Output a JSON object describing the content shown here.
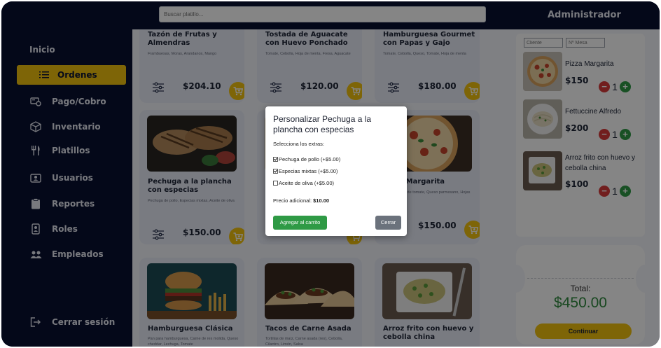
{
  "header": {
    "search_placeholder": "Buscar platillo...",
    "admin_label": "Administrador"
  },
  "sidebar": {
    "inicio": "Inicio",
    "items": [
      {
        "label": "Ordenes",
        "icon": "list-icon"
      },
      {
        "label": "Pago/Cobro",
        "icon": "payment-icon"
      },
      {
        "label": "Inventario",
        "icon": "box-icon"
      },
      {
        "label": "Platillos",
        "icon": "utensils-icon"
      },
      {
        "label": "Usuarios",
        "icon": "id-card-icon"
      },
      {
        "label": "Reportes",
        "icon": "clipboard-icon"
      },
      {
        "label": "Roles",
        "icon": "badge-icon"
      },
      {
        "label": "Empleados",
        "icon": "users-icon"
      }
    ],
    "logout": "Cerrar sesión"
  },
  "products": [
    {
      "title": "Tazón de Frutas y Almendras",
      "desc": "Frambuesas, Moras, Arandanos, Mango",
      "price": "$204.10"
    },
    {
      "title": "Tostada de Aguacate con Huevo Ponchado",
      "desc": "Tomate, Cebolla, Hoja de menta, Fresa, Aguacate",
      "price": "$120.00"
    },
    {
      "title": "Hamburguesa Gourmet con Papas y Gajo",
      "desc": "Tomate, Cebolla, Queso, Tomate, Hoja de menta",
      "price": "$180.00"
    },
    {
      "title": "Pechuga a la plancha con especias",
      "desc": "Pechuga de pollo, Especias mixtas, Aceite de oliva",
      "price": "$150.00"
    },
    {
      "title": "",
      "desc": "",
      "price": ""
    },
    {
      "title": "Pizza Margarita",
      "desc": "Queso, Salsa de tomate, Queso parmesano, Hojas de albahaca",
      "price": "$150.00"
    },
    {
      "title": "Hamburguesa Clásica",
      "desc": "Pan para hamburguesa, Carne de res molida, Queso cheddar, Lechuga, Tomate",
      "price": ""
    },
    {
      "title": "Tacos de Carne Asada",
      "desc": "Tortillas de maíz, Carne asada (res), Cebolla, Cilantro, Limón, Salsa",
      "price": ""
    },
    {
      "title": "Arroz frito con huevo y cebolla china",
      "desc": "",
      "price": ""
    }
  ],
  "order": {
    "client_placeholder": "Cliente",
    "table_placeholder": "Nº Mesa",
    "items": [
      {
        "name": "Pizza Margarita",
        "price": "$150",
        "qty": "1"
      },
      {
        "name": "Fettuccine Alfredo",
        "price": "$200",
        "qty": "1"
      },
      {
        "name": "Arroz frito con huevo y cebolla china",
        "price": "$100",
        "qty": "1"
      }
    ],
    "total_label": "Total:",
    "total_value": "$450.00",
    "continue_label": "Continuar"
  },
  "modal": {
    "title": "Personalizar Pechuga a la plancha con especias",
    "subtitle": "Selecciona los extras:",
    "options": [
      {
        "label": "Pechuga de pollo (+$5.00)",
        "checked": true
      },
      {
        "label": "Especias mixtas (+$5.00)",
        "checked": true
      },
      {
        "label": "Aceite de oliva (+$5.00)",
        "checked": false
      }
    ],
    "extra_label": "Precio adicional:",
    "extra_value": "$10.00",
    "add_label": "Agregar al carrito",
    "close_label": "Cerrar"
  },
  "colors": {
    "sidebar_bg": "#081030",
    "accent_yellow": "#f2c20f",
    "add_green": "#2f9a45",
    "remove_red": "#d83b3b",
    "total_green": "#2e8a3e"
  }
}
